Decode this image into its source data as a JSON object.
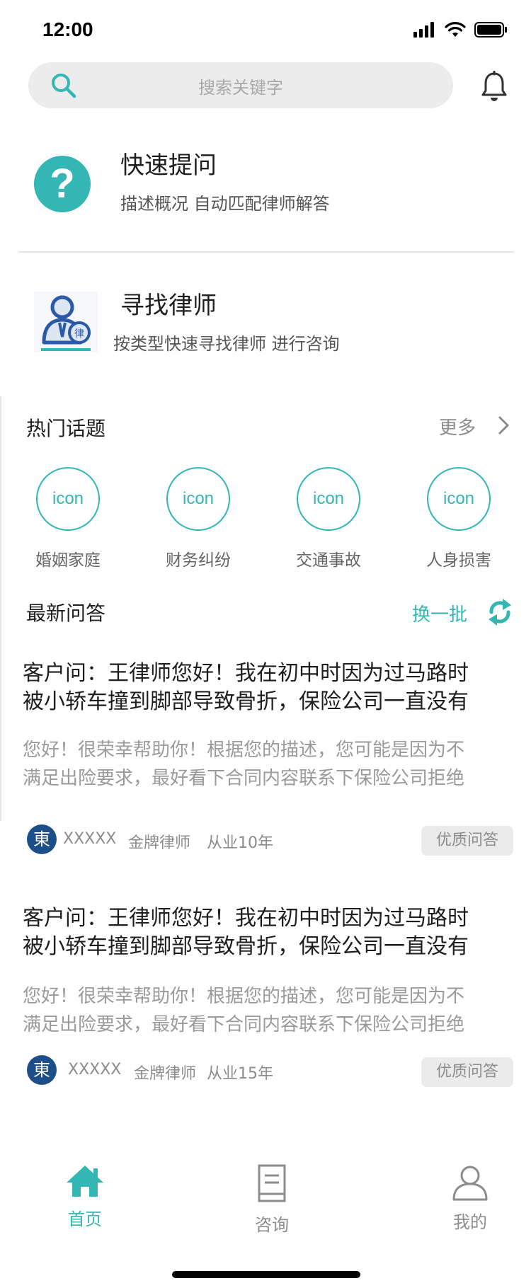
{
  "status_bar": {
    "time": "12:00"
  },
  "search": {
    "placeholder": "搜索关键字"
  },
  "quick_ask": {
    "title": "快速提问",
    "subtitle": "描述概况 自动匹配律师解答"
  },
  "find_lawyer": {
    "title": "寻找律师",
    "subtitle": "按类型快速寻找律师 进行咨询"
  },
  "hot_topics": {
    "title": "热门话题",
    "more_label": "更多",
    "items": [
      {
        "icon_text": "icon",
        "label": "婚姻家庭"
      },
      {
        "icon_text": "icon",
        "label": "财务纠纷"
      },
      {
        "icon_text": "icon",
        "label": "交通事故"
      },
      {
        "icon_text": "icon",
        "label": "人身损害"
      }
    ]
  },
  "latest_qa": {
    "title": "最新问答",
    "refresh_label": "换一批",
    "items": [
      {
        "question_line1": "客户问：王律师您好！我在初中时因为过马路时",
        "question_line2": "被小轿车撞到脚部导致骨折，保险公司一直没有",
        "answer_line1": "您好！很荣幸帮助你！根据您的描述，您可能是因为不",
        "answer_line2": "满足出险要求，最好看下合同内容联系下保险公司拒绝",
        "avatar_char": "東",
        "lawyer_name": "XXXXX",
        "lawyer_title": "金牌律师",
        "experience": "从业10年",
        "badge": "优质问答"
      },
      {
        "question_line1": "客户问：王律师您好！我在初中时因为过马路时",
        "question_line2": "被小轿车撞到脚部导致骨折，保险公司一直没有",
        "answer_line1": "您好！很荣幸帮助你！根据您的描述，您可能是因为不",
        "answer_line2": "满足出险要求，最好看下合同内容联系下保险公司拒绝",
        "avatar_char": "東",
        "lawyer_name": "XXXXX",
        "lawyer_title": "金牌律师",
        "experience": "从业15年",
        "badge": "优质问答"
      }
    ]
  },
  "tab_bar": {
    "items": [
      {
        "label": "首页",
        "icon": "home-icon",
        "active": true
      },
      {
        "label": "咨询",
        "icon": "document-icon",
        "active": false
      },
      {
        "label": "我的",
        "icon": "user-icon",
        "active": false
      }
    ]
  },
  "colors": {
    "accent": "#34b6b5",
    "muted": "#8c8c8c",
    "placeholder": "#a8a8a8",
    "avatar": "#1c4f8a"
  }
}
